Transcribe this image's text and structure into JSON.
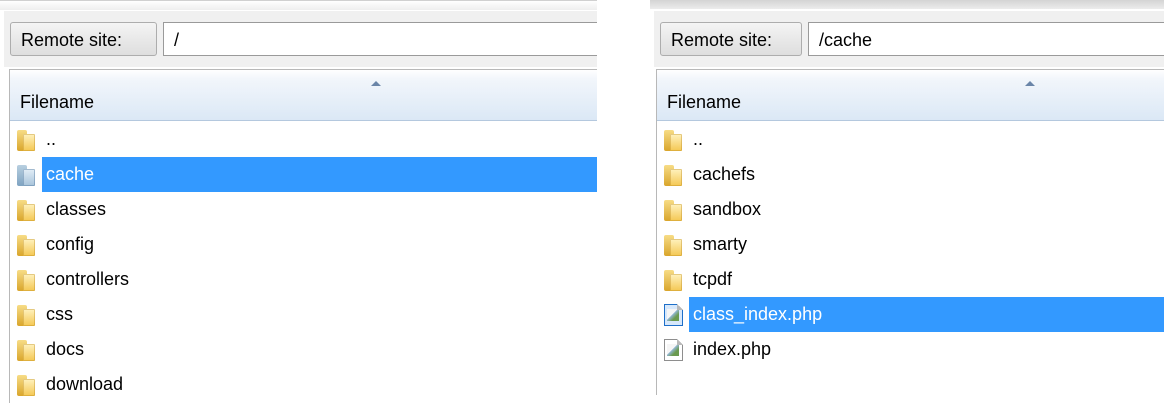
{
  "left_panel": {
    "remote_label": "Remote site:",
    "remote_path": "/",
    "column_header": "Filename",
    "items": [
      {
        "name": "..",
        "type": "folder",
        "selected": false
      },
      {
        "name": "cache",
        "type": "folder",
        "selected": true
      },
      {
        "name": "classes",
        "type": "folder",
        "selected": false
      },
      {
        "name": "config",
        "type": "folder",
        "selected": false
      },
      {
        "name": "controllers",
        "type": "folder",
        "selected": false
      },
      {
        "name": "css",
        "type": "folder",
        "selected": false
      },
      {
        "name": "docs",
        "type": "folder",
        "selected": false
      },
      {
        "name": "download",
        "type": "folder",
        "selected": false
      }
    ]
  },
  "right_panel": {
    "remote_label": "Remote site:",
    "remote_path": "/cache",
    "column_header": "Filename",
    "items": [
      {
        "name": "..",
        "type": "folder",
        "selected": false
      },
      {
        "name": "cachefs",
        "type": "folder",
        "selected": false
      },
      {
        "name": "sandbox",
        "type": "folder",
        "selected": false
      },
      {
        "name": "smarty",
        "type": "folder",
        "selected": false
      },
      {
        "name": "tcpdf",
        "type": "folder",
        "selected": false
      },
      {
        "name": "class_index.php",
        "type": "file",
        "selected": true
      },
      {
        "name": "index.php",
        "type": "file",
        "selected": false
      }
    ]
  },
  "colors": {
    "selection": "#3399ff",
    "header_gradient_end": "#dbe8f6"
  },
  "icons": {
    "folder": "folder-icon",
    "file": "php-file-icon",
    "sort": "sort-ascending-icon"
  }
}
